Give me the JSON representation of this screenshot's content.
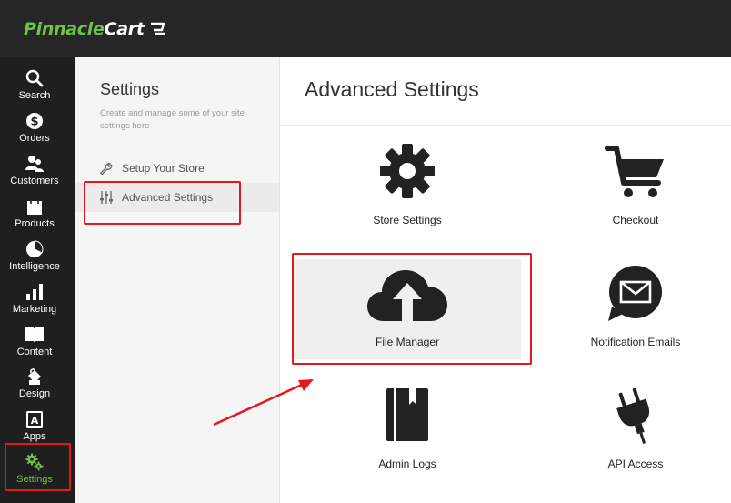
{
  "app": {
    "logo_part1": "Pinnacle",
    "logo_part2": "Cart"
  },
  "nav": [
    {
      "label": "Search",
      "icon": "search-icon"
    },
    {
      "label": "Orders",
      "icon": "dollar-icon"
    },
    {
      "label": "Customers",
      "icon": "users-icon"
    },
    {
      "label": "Products",
      "icon": "bag-icon"
    },
    {
      "label": "Intelligence",
      "icon": "pie-chart-icon"
    },
    {
      "label": "Marketing",
      "icon": "bar-chart-icon"
    },
    {
      "label": "Content",
      "icon": "book-icon"
    },
    {
      "label": "Design",
      "icon": "paint-bucket-icon"
    },
    {
      "label": "Apps",
      "icon": "apps-icon"
    },
    {
      "label": "Settings",
      "icon": "gears-icon",
      "active": true
    }
  ],
  "settings_panel": {
    "title": "Settings",
    "description": "Create and manage some of your site settings here",
    "items": [
      {
        "label": "Setup Your Store",
        "icon": "wrench-icon"
      },
      {
        "label": "Advanced Settings",
        "icon": "sliders-icon",
        "selected": true
      }
    ]
  },
  "main": {
    "title": "Advanced Settings",
    "tiles": [
      {
        "label": "Store Settings",
        "icon": "gear-icon"
      },
      {
        "label": "Checkout",
        "icon": "cart-icon"
      },
      {
        "label": "File Manager",
        "icon": "cloud-upload-icon",
        "highlighted": true
      },
      {
        "label": "Notification Emails",
        "icon": "mail-bubble-icon"
      },
      {
        "label": "Admin Logs",
        "icon": "notebook-icon"
      },
      {
        "label": "API Access",
        "icon": "plug-icon"
      }
    ]
  },
  "colors": {
    "accent": "#6cc24a",
    "annotation": "#e4171e",
    "topbar": "#262626",
    "sidebar": "#1f1f1f"
  }
}
